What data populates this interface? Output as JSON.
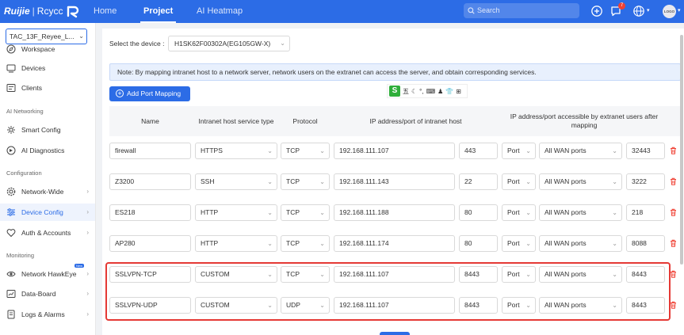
{
  "brand": {
    "name1": "Ruijie",
    "separator": "|",
    "name2": "Rcycc"
  },
  "nav": {
    "tabs": [
      "Home",
      "Project",
      "AI Heatmap"
    ],
    "active": "Project"
  },
  "topbar": {
    "search_placeholder": "Search",
    "notification_count": "7",
    "avatar_text": "LOGO"
  },
  "sidebar": {
    "project": "TAC_13F_Reyee_L...",
    "top_items": [
      {
        "label": "Workspace",
        "icon": "compass-icon"
      },
      {
        "label": "Devices",
        "icon": "devices-icon"
      },
      {
        "label": "Clients",
        "icon": "clients-icon"
      }
    ],
    "sections": [
      {
        "title": "AI Networking",
        "items": [
          {
            "label": "Smart Config",
            "icon": "smart-config-icon"
          },
          {
            "label": "AI Diagnostics",
            "icon": "diagnostics-icon"
          }
        ]
      },
      {
        "title": "Configuration",
        "items": [
          {
            "label": "Network-Wide",
            "icon": "gear-icon",
            "arrow": true
          },
          {
            "label": "Device Config",
            "icon": "device-config-icon",
            "arrow": true,
            "active": true
          },
          {
            "label": "Auth & Accounts",
            "icon": "heart-icon",
            "arrow": true
          }
        ]
      },
      {
        "title": "Monitoring",
        "items": [
          {
            "label": "Network HawkEye",
            "icon": "hawkeye-icon",
            "arrow": true,
            "tag": "New"
          },
          {
            "label": "Data-Board",
            "icon": "board-icon",
            "arrow": true
          },
          {
            "label": "Logs & Alarms",
            "icon": "logs-icon",
            "arrow": true
          }
        ]
      }
    ]
  },
  "main": {
    "device_label": "Select the device :",
    "device_value": "H1SK62F00302A(EG105GW-X)",
    "note": "Note: By mapping intranet host to a network server, network users on the extranet can access the server, and obtain corresponding services.",
    "add_button": "Add Port Mapping",
    "ime_toolbar": {
      "logo": "S",
      "items": [
        "五",
        "☾",
        "°,",
        "⌨",
        "♟",
        "👕",
        "⊞"
      ]
    },
    "headers": [
      "Name",
      "Intranet host service type",
      "Protocol",
      "IP address/port of intranet host",
      "IP address/port accessible by extranet users after mapping"
    ],
    "rows": [
      {
        "name": "firewall",
        "service": "HTTPS",
        "protocol": "TCP",
        "ip": "192.168.111.107",
        "port": "443",
        "port_type": "Port",
        "wan": "All WAN ports",
        "ext_port": "32443"
      },
      {
        "name": "Z3200",
        "service": "SSH",
        "protocol": "TCP",
        "ip": "192.168.111.143",
        "port": "22",
        "port_type": "Port",
        "wan": "All WAN ports",
        "ext_port": "3222"
      },
      {
        "name": "ES218",
        "service": "HTTP",
        "protocol": "TCP",
        "ip": "192.168.111.188",
        "port": "80",
        "port_type": "Port",
        "wan": "All WAN ports",
        "ext_port": "218"
      },
      {
        "name": "AP280",
        "service": "HTTP",
        "protocol": "TCP",
        "ip": "192.168.111.174",
        "port": "80",
        "port_type": "Port",
        "wan": "All WAN ports",
        "ext_port": "8088"
      },
      {
        "name": "SSLVPN-TCP",
        "service": "CUSTOM",
        "protocol": "TCP",
        "ip": "192.168.111.107",
        "port": "8443",
        "port_type": "Port",
        "wan": "All WAN ports",
        "ext_port": "8443"
      },
      {
        "name": "SSLVPN-UDP",
        "service": "CUSTOM",
        "protocol": "UDP",
        "ip": "192.168.111.107",
        "port": "8443",
        "port_type": "Port",
        "wan": "All WAN ports",
        "ext_port": "8443"
      }
    ]
  },
  "colors": {
    "primary": "#2c6ce6",
    "highlight": "#e53935",
    "delete": "#f04134"
  }
}
